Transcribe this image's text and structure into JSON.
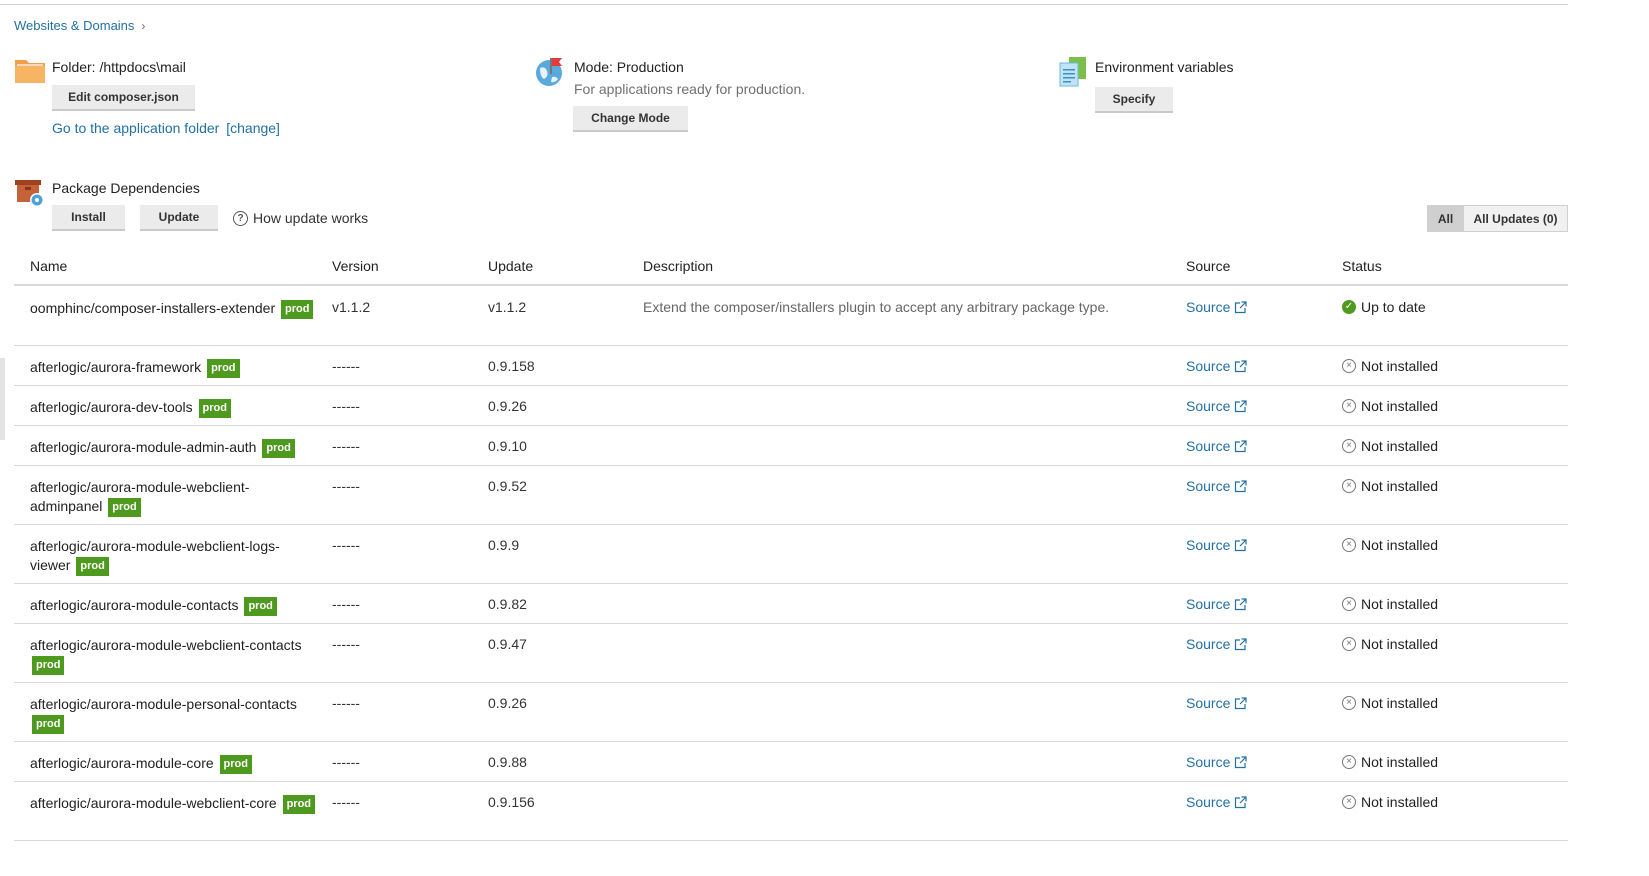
{
  "breadcrumb": {
    "label": "Websites & Domains",
    "chevron": "›"
  },
  "folder": {
    "title": "Folder: /httpdocs\\mail",
    "edit_label": "Edit composer.json",
    "goto_link": "Go to the application folder",
    "change_link": "[change]",
    "icon": "folder-icon"
  },
  "mode": {
    "title": "Mode: Production",
    "subtitle": "For applications ready for production.",
    "button_label": "Change Mode",
    "icon": "globe-flag-icon"
  },
  "env": {
    "title": "Environment variables",
    "button_label": "Specify",
    "icon": "document-list-icon"
  },
  "packages": {
    "title": "Package Dependencies",
    "install_label": "Install",
    "update_label": "Update",
    "how_label": "How update works",
    "filter_all": "All",
    "filter_updates": "All Updates (0)",
    "icon": "package-box-icon"
  },
  "table": {
    "columns": {
      "name": "Name",
      "version": "Version",
      "update": "Update",
      "description": "Description",
      "source": "Source",
      "status": "Status"
    },
    "badge_label": "prod",
    "rows": [
      {
        "name": "oomphinc/composer-installers-extender",
        "version": "v1.1.2",
        "update": "v1.1.2",
        "description": "Extend the composer/installers plugin to accept any arbitrary package type.",
        "source": "Source",
        "status": "Up to date",
        "status_kind": "ok"
      },
      {
        "name": "afterlogic/aurora-framework",
        "version": "------",
        "update": "0.9.158",
        "description": "",
        "source": "Source",
        "status": "Not installed",
        "status_kind": "missing"
      },
      {
        "name": "afterlogic/aurora-dev-tools",
        "version": "------",
        "update": "0.9.26",
        "description": "",
        "source": "Source",
        "status": "Not installed",
        "status_kind": "missing"
      },
      {
        "name": "afterlogic/aurora-module-admin-auth",
        "version": "------",
        "update": "0.9.10",
        "description": "",
        "source": "Source",
        "status": "Not installed",
        "status_kind": "missing"
      },
      {
        "name": "afterlogic/aurora-module-webclient-adminpanel",
        "version": "------",
        "update": "0.9.52",
        "description": "",
        "source": "Source",
        "status": "Not installed",
        "status_kind": "missing"
      },
      {
        "name": "afterlogic/aurora-module-webclient-logs-viewer",
        "version": "------",
        "update": "0.9.9",
        "description": "",
        "source": "Source",
        "status": "Not installed",
        "status_kind": "missing"
      },
      {
        "name": "afterlogic/aurora-module-contacts",
        "version": "------",
        "update": "0.9.82",
        "description": "",
        "source": "Source",
        "status": "Not installed",
        "status_kind": "missing"
      },
      {
        "name": "afterlogic/aurora-module-webclient-contacts",
        "version": "------",
        "update": "0.9.47",
        "description": "",
        "source": "Source",
        "status": "Not installed",
        "status_kind": "missing"
      },
      {
        "name": "afterlogic/aurora-module-personal-contacts",
        "version": "------",
        "update": "0.9.26",
        "description": "",
        "source": "Source",
        "status": "Not installed",
        "status_kind": "missing"
      },
      {
        "name": "afterlogic/aurora-module-core",
        "version": "------",
        "update": "0.9.88",
        "description": "",
        "source": "Source",
        "status": "Not installed",
        "status_kind": "missing"
      },
      {
        "name": "afterlogic/aurora-module-webclient-core",
        "version": "------",
        "update": "0.9.156",
        "description": "",
        "source": "Source",
        "status": "Not installed",
        "status_kind": "missing"
      }
    ]
  },
  "colors": {
    "link": "#2370a3",
    "badge": "#4e9a1e",
    "ok": "#4e9a1e"
  }
}
